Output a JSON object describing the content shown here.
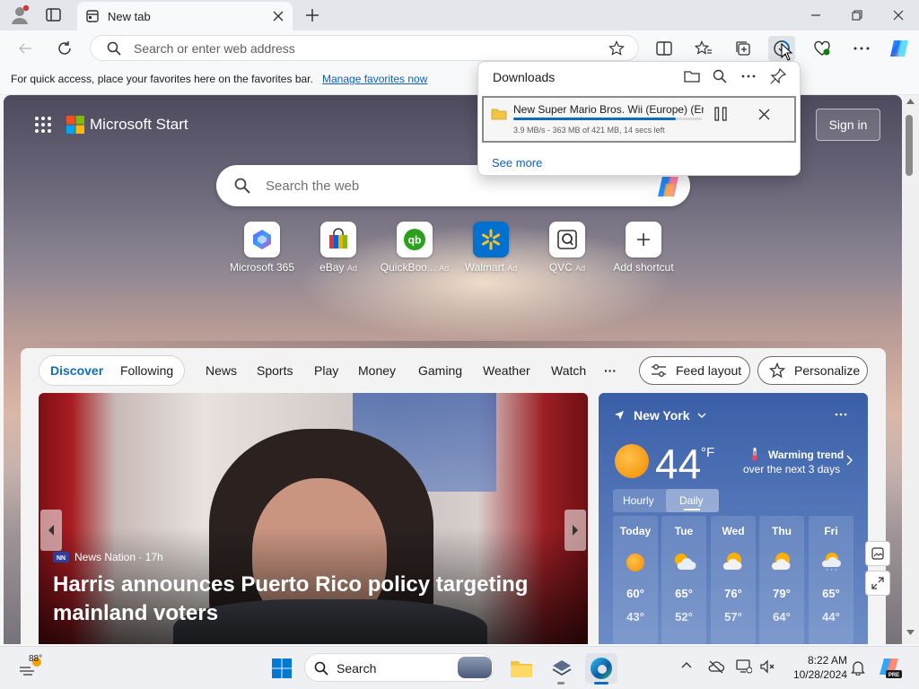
{
  "browser": {
    "tab_title": "New tab",
    "address_placeholder": "Search or enter web address",
    "favorites_bar_message": "For quick access, place your favorites here on the favorites bar.",
    "favorites_bar_link": "Manage favorites now"
  },
  "start": {
    "brand": "Microsoft Start",
    "sign_in": "Sign in",
    "search_placeholder": "Search the web",
    "shortcuts": [
      {
        "label": "Microsoft 365",
        "ad": ""
      },
      {
        "label": "eBay",
        "ad": "Ad"
      },
      {
        "label": "QuickBoo...",
        "ad": "Ad"
      },
      {
        "label": "Walmart",
        "ad": "Ad"
      },
      {
        "label": "QVC",
        "ad": "Ad"
      },
      {
        "label": "Add shortcut",
        "ad": ""
      }
    ]
  },
  "feed": {
    "tabs": [
      "Discover",
      "Following"
    ],
    "nav": [
      "News",
      "Sports",
      "Play",
      "Money",
      "Gaming",
      "Weather",
      "Watch"
    ],
    "more": "···",
    "feed_layout": "Feed layout",
    "personalize": "Personalize"
  },
  "news": {
    "source": "News Nation",
    "age": "· 17h",
    "headline": "Harris announces Puerto Rico policy targeting mainland voters"
  },
  "weather": {
    "city": "New York",
    "temp": "44",
    "unit": "°F",
    "trend_line1": "Warming trend",
    "trend_line2": "over the next 3 days",
    "tab_hourly": "Hourly",
    "tab_daily": "Daily",
    "days": [
      {
        "name": "Today",
        "hi": "60°",
        "lo": "43°",
        "icon": "sun"
      },
      {
        "name": "Tue",
        "hi": "65°",
        "lo": "52°",
        "icon": "partly-cloudy"
      },
      {
        "name": "Wed",
        "hi": "76°",
        "lo": "57°",
        "icon": "partly-cloudy"
      },
      {
        "name": "Thu",
        "hi": "79°",
        "lo": "64°",
        "icon": "partly-cloudy"
      },
      {
        "name": "Fri",
        "hi": "65°",
        "lo": "44°",
        "icon": "rain-cloud"
      }
    ]
  },
  "downloads": {
    "title": "Downloads",
    "file_name": "New Super Mario Bros. Wii (Europe) (En",
    "status": "3.9 MB/s - 363 MB of 421 MB, 14 secs left",
    "progress": 0.86,
    "see_more": "See more"
  },
  "taskbar": {
    "weather_temp": "88°",
    "search_label": "Search",
    "time": "8:22 AM",
    "date": "10/28/2024"
  },
  "colors": {
    "accent": "#0f6cbd",
    "weather_bg": "#4f72b6",
    "news_red": "#a81c22"
  }
}
